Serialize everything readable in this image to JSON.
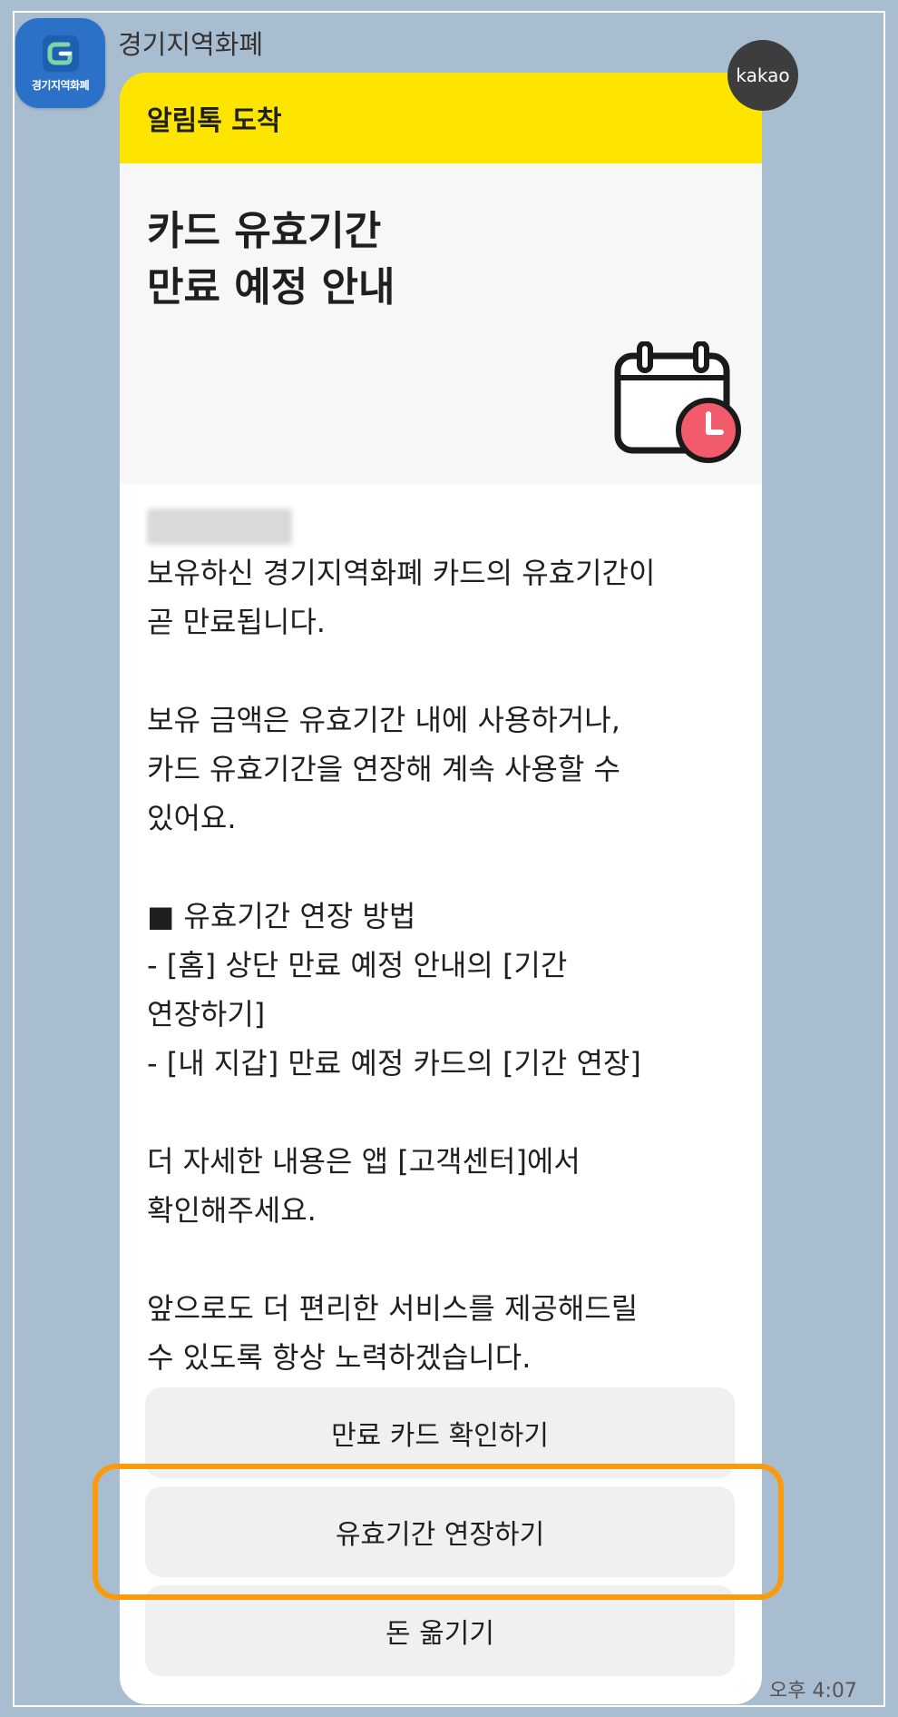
{
  "sender": {
    "name": "경기지역화폐",
    "avatar_text": "경기지역화폐"
  },
  "badge": "kakao",
  "message": {
    "header": "알림톡 도착",
    "title_lines": [
      "카드 유효기간",
      "만료 예정 안내"
    ],
    "body_lines": [
      "보유하신 경기지역화폐 카드의 유효기간이",
      "곧 만료됩니다.",
      "",
      "보유 금액은 유효기간 내에 사용하거나,",
      "카드 유효기간을 연장해 계속 사용할 수",
      "있어요.",
      "",
      "■ 유효기간 연장 방법",
      "- [홈] 상단 만료 예정 안내의 [기간",
      "연장하기]",
      "- [내 지갑] 만료 예정 카드의 [기간 연장]",
      "",
      "더 자세한 내용은 앱 [고객센터]에서",
      "확인해주세요.",
      "",
      "앞으로도 더 편리한 서비스를 제공해드릴",
      "수 있도록 항상 노력하겠습니다."
    ],
    "buttons": [
      "만료 카드 확인하기",
      "유효기간 연장하기",
      "돈 옮기기"
    ]
  },
  "timestamp": "오후 4:07",
  "colors": {
    "background": "#a9bdd1",
    "header_yellow": "#fee500",
    "highlight": "#f99b0c",
    "avatar": "#2c71c8"
  },
  "icons": {
    "avatar": "gyeonggi-currency-logo-icon",
    "illustration": "calendar-clock-icon"
  }
}
